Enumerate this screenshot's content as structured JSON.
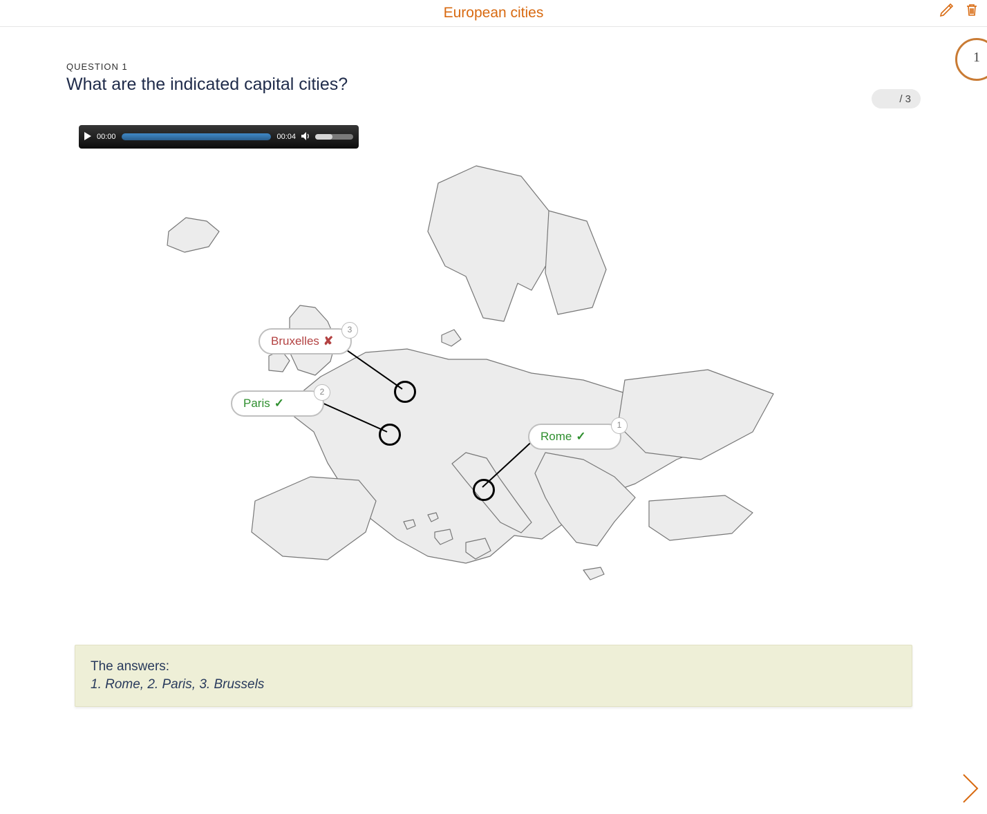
{
  "header": {
    "title": "European cities"
  },
  "counter": {
    "current": "1"
  },
  "question": {
    "label": "QUESTION 1",
    "text": "What are the indicated capital cities?",
    "score_total": "/ 3"
  },
  "audio": {
    "current": "00:00",
    "total": "00:04"
  },
  "labels": {
    "bruxelles": {
      "text": "Bruxelles",
      "mark": "✘",
      "num": "3"
    },
    "paris": {
      "text": "Paris",
      "mark": "✓",
      "num": "2"
    },
    "rome": {
      "text": "Rome",
      "mark": "✓",
      "num": "1"
    }
  },
  "answers": {
    "title": "The answers:",
    "line": "1. Rome, 2. Paris, 3. Brussels"
  }
}
